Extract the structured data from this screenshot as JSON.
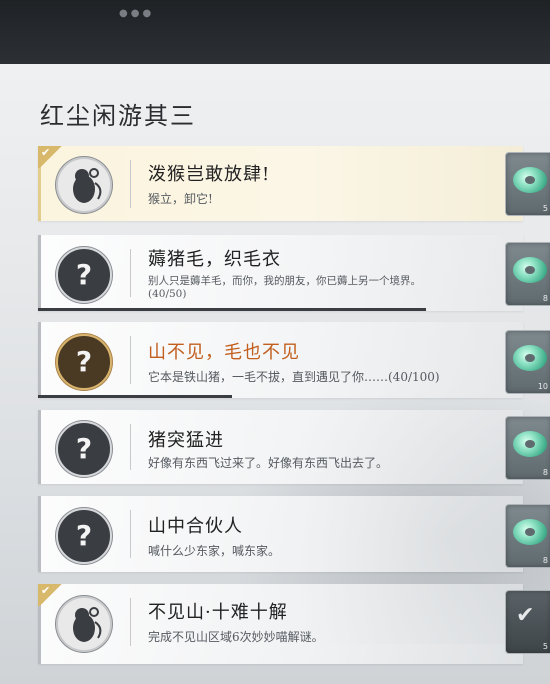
{
  "header": {
    "title": "红尘闲游其三"
  },
  "quests": [
    {
      "icon": "monkey-icon",
      "title": "泼猴岂敢放肆!",
      "desc": "猴立，卸它!",
      "completed": true,
      "reward_count": "5"
    },
    {
      "icon": "question-icon",
      "title": "薅猪毛，织毛衣",
      "desc": "别人只是薅羊毛，而你，我的朋友，你已薅上另一个境界。",
      "desc2": "(40/50)",
      "progress": 0.8,
      "reward_count": "8"
    },
    {
      "icon": "question-icon",
      "title": "山不见，毛也不见",
      "desc": "它本是铁山猪，一毛不拔，直到遇见了你……(40/100)",
      "progress": 0.4,
      "highlight": true,
      "reward_count": "10"
    },
    {
      "icon": "question-icon",
      "title": "猪突猛进",
      "desc": "好像有东西飞过来了。好像有东西飞出去了。",
      "reward_count": "8"
    },
    {
      "icon": "question-icon",
      "title": "山中合伙人",
      "desc": "喊什么少东家，喊东家。",
      "reward_count": "8"
    },
    {
      "icon": "monkey-icon",
      "title": "不见山·十难十解",
      "desc": "完成不见山区域6次妙妙喵解谜。",
      "completed": true,
      "reward_count": "5",
      "reward_claimed": true
    }
  ],
  "glyphs": {
    "question": "?",
    "check": "✔",
    "corner_check": "✔"
  }
}
